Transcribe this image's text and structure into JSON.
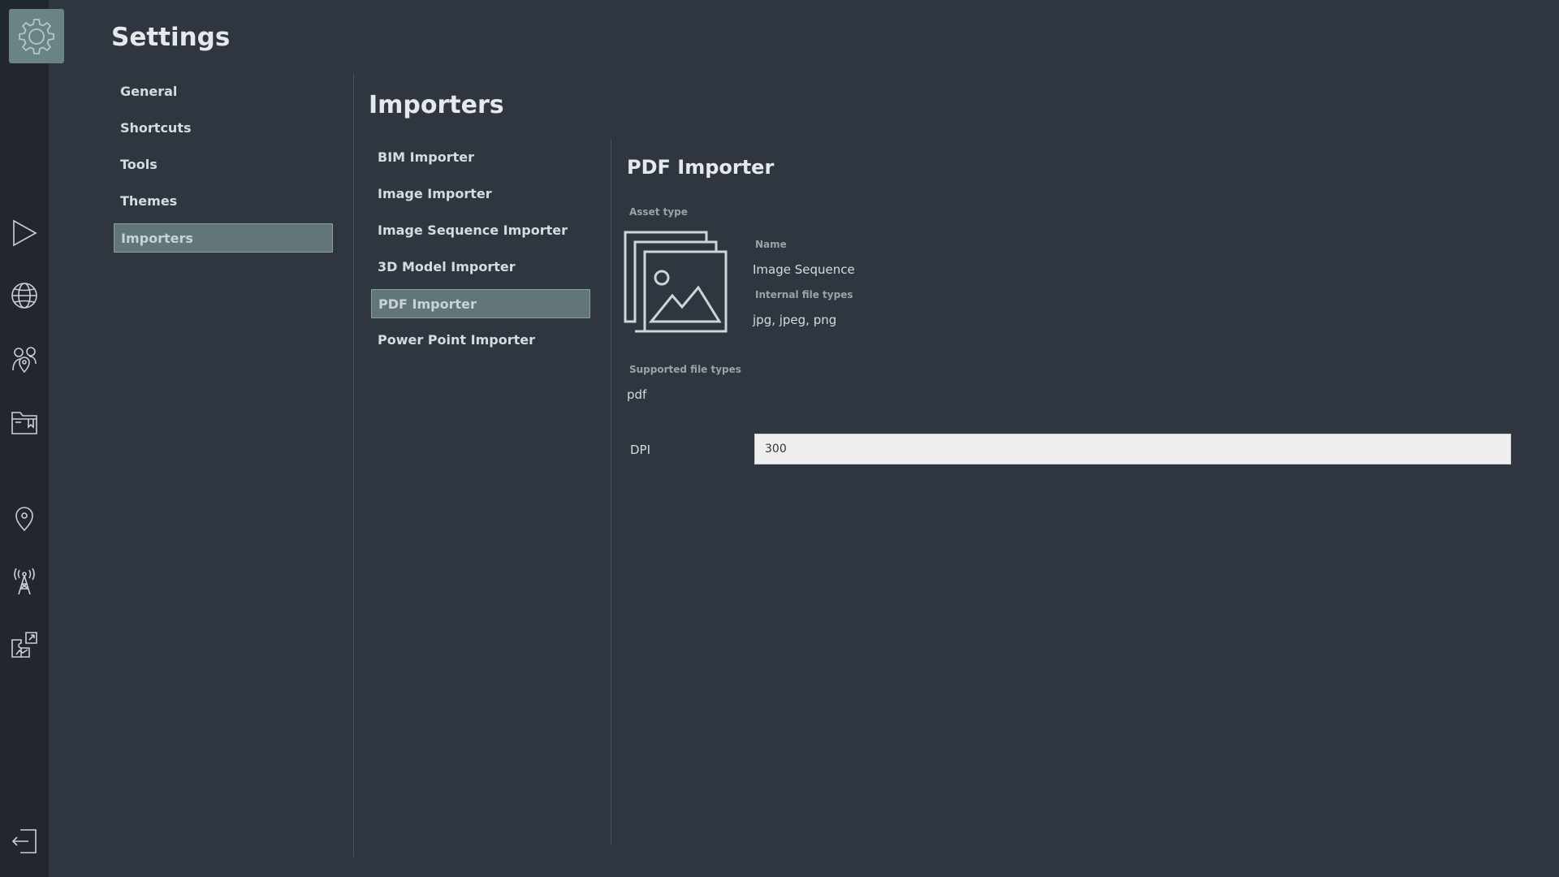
{
  "page": {
    "title": "Settings"
  },
  "rail": {
    "icons": [
      "gear-icon",
      "play-icon",
      "globe-icon",
      "people-location-icon",
      "folder-icon",
      "location-pin-icon",
      "antenna-icon",
      "puzzle-icon",
      "logout-icon"
    ]
  },
  "settings_menu": {
    "items": [
      {
        "label": "General"
      },
      {
        "label": "Shortcuts"
      },
      {
        "label": "Tools"
      },
      {
        "label": "Themes"
      },
      {
        "label": "Importers",
        "active": true
      }
    ]
  },
  "importers": {
    "title": "Importers",
    "items": [
      {
        "label": "BIM Importer"
      },
      {
        "label": "Image Importer"
      },
      {
        "label": "Image Sequence Importer"
      },
      {
        "label": "3D Model Importer"
      },
      {
        "label": "PDF Importer",
        "active": true
      },
      {
        "label": "Power Point Importer"
      }
    ]
  },
  "detail": {
    "title": "PDF Importer",
    "asset_type_label": "Asset type",
    "asset_icon": "image-stack-icon",
    "name_label": "Name",
    "name_value": "Image Sequence",
    "internal_types_label": "Internal file types",
    "internal_types_value": "jpg, jpeg, png",
    "supported_types_label": "Supported file types",
    "supported_types_value": "pdf",
    "dpi_label": "DPI",
    "dpi_value": "300"
  },
  "colors": {
    "background": "#2f3640",
    "rail": "#22272e",
    "active_item": "#627679",
    "logo_bg": "#6a8485"
  }
}
